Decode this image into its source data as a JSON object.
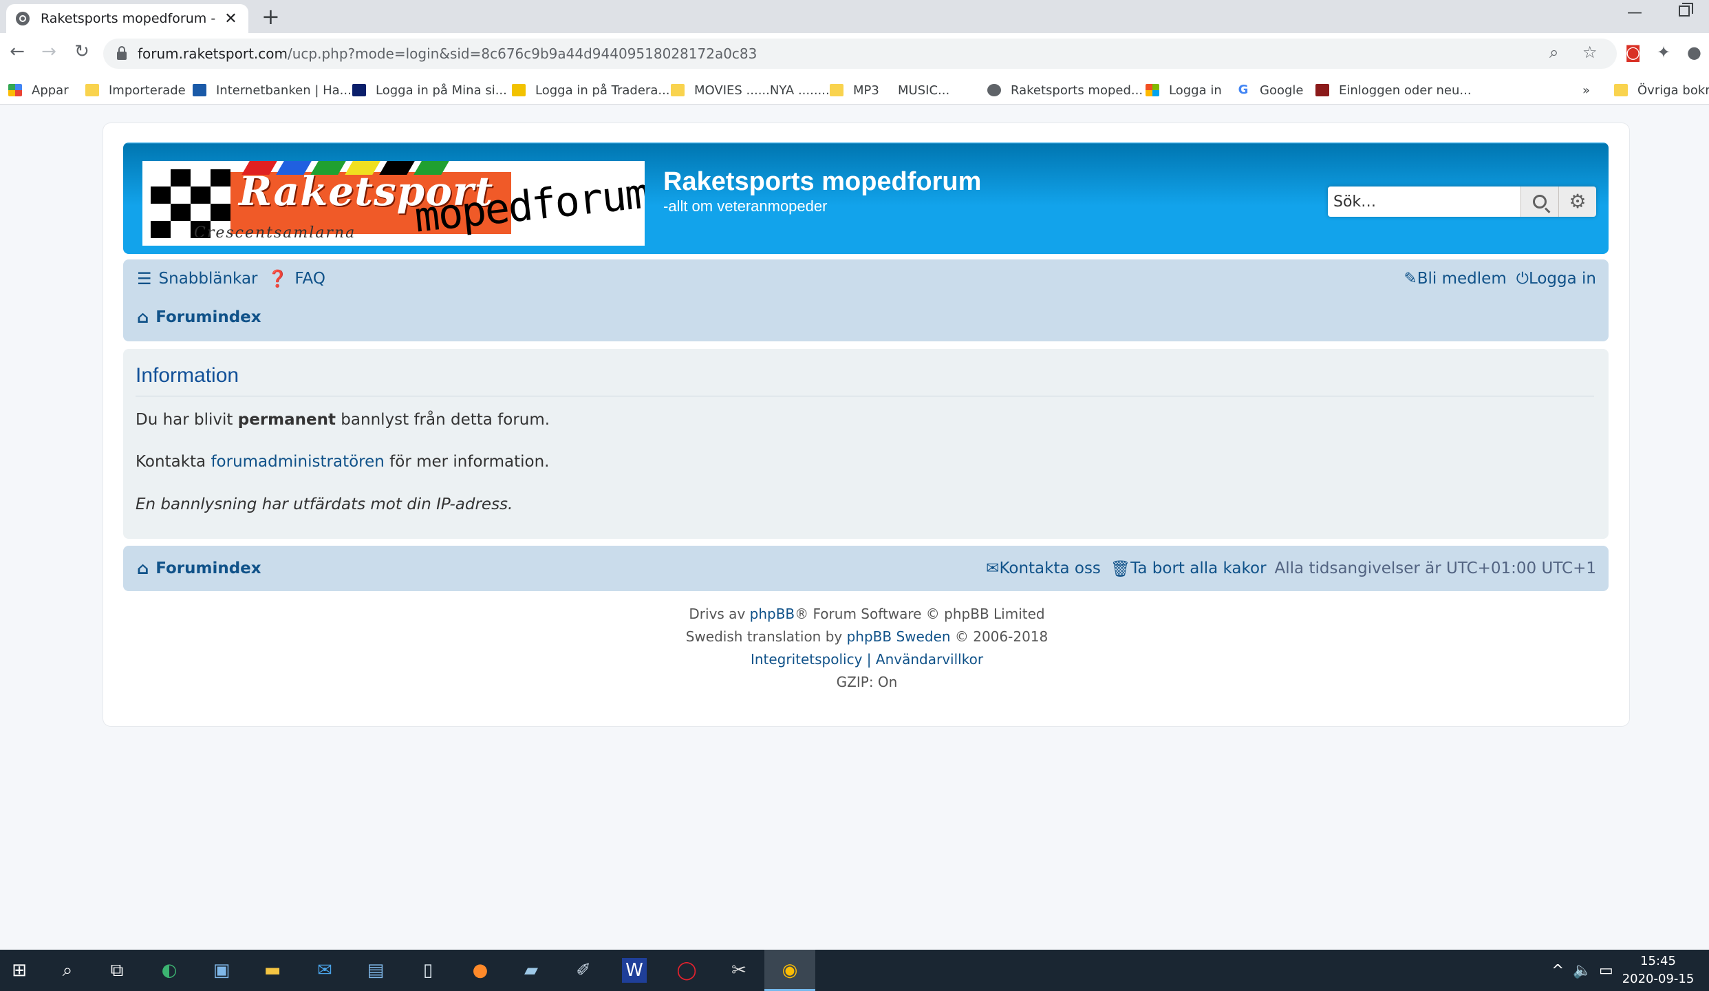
{
  "browser": {
    "tab_title": "Raketsports mopedforum - Infor",
    "tab_close": "✕",
    "new_tab": "+",
    "url_host": "forum.raketsport.com",
    "url_path": "/ucp.php?mode=login&sid=8c676c9b9a44d94409518028172a0c83",
    "bookmarks": [
      {
        "label": "Appar",
        "icon": "apps-grid-icon"
      },
      {
        "label": "Importerade",
        "icon": "folder-icon"
      },
      {
        "label": "Internetbanken | Ha...",
        "icon": "handelsbanken-icon"
      },
      {
        "label": "Logga in på Mina si...",
        "icon": "site-icon"
      },
      {
        "label": "Logga in på Tradera...",
        "icon": "tradera-icon"
      },
      {
        "label": "MOVIES ......NYA .........",
        "icon": "folder-icon"
      },
      {
        "label": "MP3",
        "icon": "folder-icon"
      },
      {
        "label": "MUSIC...",
        "icon": "none"
      },
      {
        "label": "Raketsports moped...",
        "icon": "globe-icon"
      },
      {
        "label": "Logga in",
        "icon": "microsoft-icon"
      },
      {
        "label": "Google",
        "icon": "google-icon"
      },
      {
        "label": "Einloggen oder neu...",
        "icon": "site-icon"
      }
    ],
    "bookmarks_more": "»",
    "other_bookmarks": "Övriga bokm"
  },
  "site": {
    "title": "Raketsports mopedforum",
    "description": "-allt om veteranmopeder",
    "logo_text_main": "Raketsport",
    "logo_text_sub": "mopedforum",
    "logo_text_small": "Crescentsamlarna",
    "search_placeholder": "Sök…"
  },
  "nav": {
    "quicklinks": "Snabblänkar",
    "faq": "FAQ",
    "register": "Bli medlem",
    "login": "Logga in",
    "forum_index": "Forumindex"
  },
  "info": {
    "title": "Information",
    "line1_pre": "Du har blivit ",
    "line1_bold": "permanent",
    "line1_post": " bannlyst från detta forum.",
    "line2_pre": "Kontakta ",
    "line2_link": "forumadministratören",
    "line2_post": " för mer information.",
    "line3": "En bannlysning har utfärdats mot din IP-adress."
  },
  "footer": {
    "forum_index": "Forumindex",
    "contact": "Kontakta oss",
    "delete_cookies": "Ta bort alla kakor",
    "timezone": "Alla tidsangivelser är UTC+01:00 UTC+1",
    "powered_pre": "Drivs av ",
    "powered_link": "phpBB",
    "powered_post": "® Forum Software © phpBB Limited",
    "translation_pre": "Swedish translation by ",
    "translation_link": "phpBB Sweden",
    "translation_post": " © 2006-2018",
    "privacy": "Integritetspolicy",
    "separator": "|",
    "terms": "Användarvillkor",
    "gzip": "GZIP: On"
  },
  "taskbar": {
    "time": "15:45",
    "date": "2020-09-15"
  }
}
